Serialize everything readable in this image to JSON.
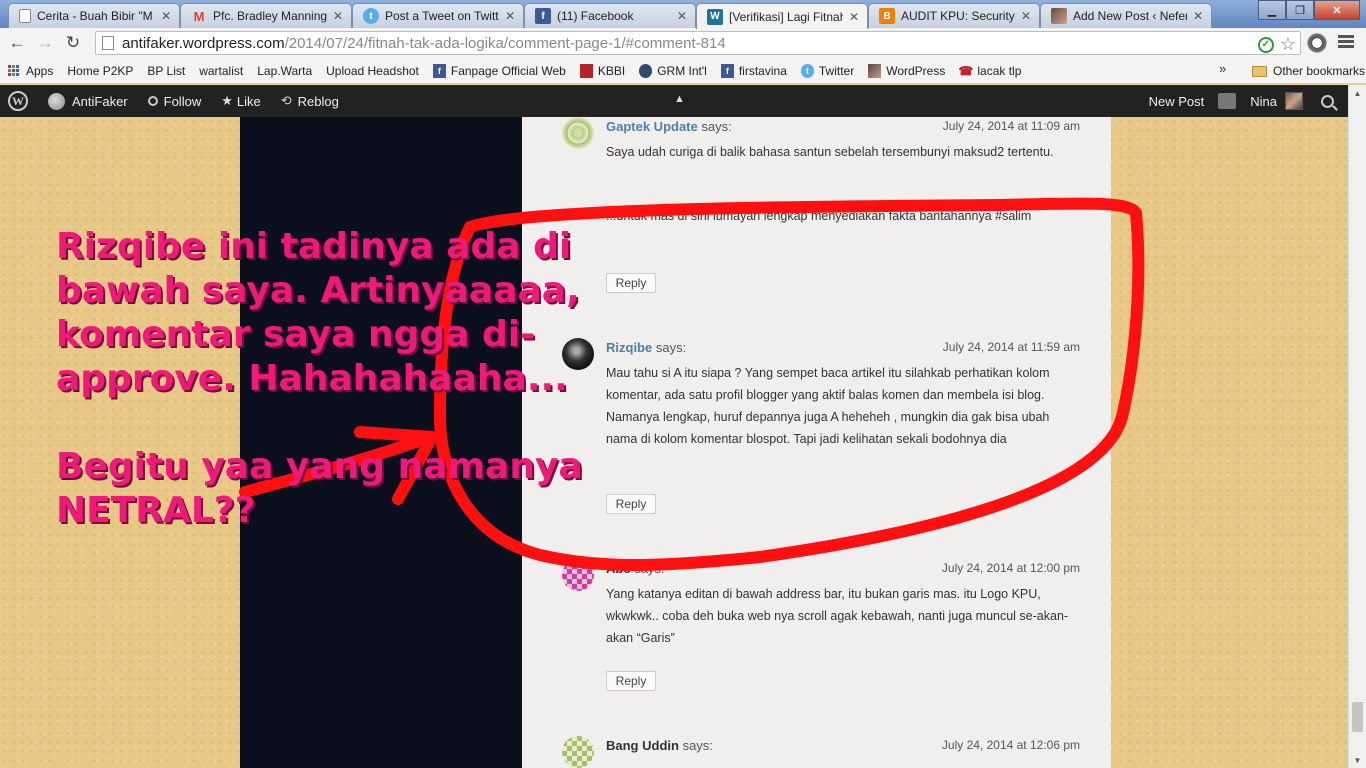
{
  "tabs": [
    {
      "title": "Cerita - Buah Bibir \"M",
      "icon": "page-icon",
      "color": "#ffffff"
    },
    {
      "title": "Pfc. Bradley Manning",
      "icon": "gmail-icon",
      "color": "#d14836"
    },
    {
      "title": "Post a Tweet on Twitt",
      "icon": "twitter-icon",
      "color": "#55acee"
    },
    {
      "title": "(11) Facebook",
      "icon": "facebook-icon",
      "color": "#3b5998"
    },
    {
      "title": "[Verifikasi] Lagi Fitnah",
      "icon": "wordpress-icon",
      "color": "#21759b"
    },
    {
      "title": "AUDIT KPU: Security A",
      "icon": "blogger-icon",
      "color": "#f57d00"
    },
    {
      "title": "Add New Post ‹ Nefer",
      "icon": "avatar-icon",
      "color": "#8a6a58"
    }
  ],
  "address": {
    "host": "antifaker.wordpress.com",
    "path": "/2014/07/24/fitnah-tak-ada-logika/comment-page-1/#comment-814"
  },
  "bookmarks": [
    {
      "label": "Apps",
      "icon": "apps-icon"
    },
    {
      "label": "Home P2KP",
      "icon": "page-icon"
    },
    {
      "label": "BP List",
      "icon": "page-icon"
    },
    {
      "label": "wartalist",
      "icon": "page-icon"
    },
    {
      "label": "Lap.Warta",
      "icon": "page-icon"
    },
    {
      "label": "Upload Headshot",
      "icon": "page-icon"
    },
    {
      "label": "Fanpage Official Web",
      "icon": "facebook-icon"
    },
    {
      "label": "KBBI",
      "icon": "kbbi-icon"
    },
    {
      "label": "GRM Int'l",
      "icon": "grm-icon"
    },
    {
      "label": "firstavina",
      "icon": "facebook-icon"
    },
    {
      "label": "Twitter",
      "icon": "twitter-icon"
    },
    {
      "label": "WordPress",
      "icon": "wordpress-avatar-icon"
    },
    {
      "label": "lacak tlp",
      "icon": "phone-icon"
    }
  ],
  "bookmarks_more": "»",
  "other_bookmarks": "Other bookmarks",
  "wpbar": {
    "site": "AntiFaker",
    "follow": "Follow",
    "like": "Like",
    "reblog": "Reblog",
    "new_post": "New Post",
    "user": "Nina"
  },
  "comments": [
    {
      "author": "Gaptek Update",
      "says": "says:",
      "date": "July 24, 2014 at 11:09 am",
      "text": "Saya udah curiga di balik bahasa santun sebelah tersembunyi maksud2 tertentu."
    },
    {
      "author": "",
      "says": "",
      "date": "",
      "text": "...untuk mas di sini lumayan lengkap menyediakan fakta bantahannya #salim",
      "reply": "Reply"
    },
    {
      "author": "Rizqibe",
      "says": "says:",
      "date": "July 24, 2014 at 11:59 am",
      "text": "Mau tahu si A itu siapa ? Yang sempet baca artikel itu silahkab perhatikan kolom komentar, ada satu profil blogger yang aktif balas komen dan membela isi blog. Namanya lengkap, huruf depannya juga A heheheh , mungkin dia gak bisa ubah nama di kolom komentar blospot. Tapi jadi kelihatan sekali bodohnya dia",
      "reply": "Reply"
    },
    {
      "author": "Abc",
      "says": "says:",
      "date": "July 24, 2014 at 12:00 pm",
      "text": "Yang katanya editan di bawah address bar, itu bukan garis mas. itu Logo KPU, wkwkwk.. coba deh buka web nya scroll agak kebawah, nanti juga muncul se-akan-akan “Garis”",
      "reply": "Reply"
    },
    {
      "author": "Bang Uddin",
      "says": "says:",
      "date": "July 24, 2014 at 12:06 pm",
      "text": ""
    }
  ],
  "annotation": {
    "para1": "Rizqibe ini tadinya ada di bawah saya. Artinyaaaaa, komentar saya ngga di-approve. Hahahahaaha...",
    "para2": "Begitu yaa yang namanya NETRAL??",
    "color": "#ee1a7a",
    "stroke_color": "#ff1010"
  }
}
